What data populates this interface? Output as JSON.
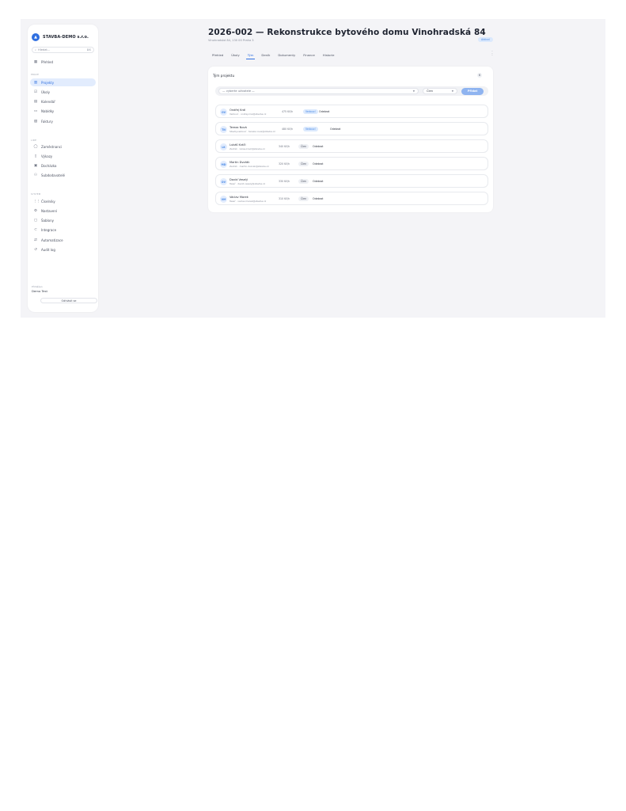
{
  "sidebar": {
    "brand": "STAVBA-DEMO s.r.o.",
    "search": {
      "placeholder": "Hledat...",
      "shortcut": "⌘K"
    },
    "items_top": [
      {
        "label": "Přehled",
        "icon": "dashboard-icon"
      }
    ],
    "group_work": "PRÁCE",
    "items_work": [
      {
        "label": "Projekty",
        "icon": "building-icon",
        "active": true
      },
      {
        "label": "Úkoly",
        "icon": "tasks-icon"
      },
      {
        "label": "Kalendář",
        "icon": "calendar-icon"
      },
      {
        "label": "Nabídky",
        "icon": "offer-icon"
      },
      {
        "label": "Faktury",
        "icon": "invoice-icon"
      }
    ],
    "group_people": "LIDÉ",
    "items_people": [
      {
        "label": "Zaměstnanci",
        "icon": "user-icon"
      },
      {
        "label": "Výkazy",
        "icon": "timesheet-icon"
      },
      {
        "label": "Docházka",
        "icon": "attendance-icon"
      },
      {
        "label": "Subdodavatelé",
        "icon": "people-icon"
      }
    ],
    "group_system": "SYSTÉM",
    "items_system": [
      {
        "label": "Číselníky",
        "icon": "grid-icon"
      },
      {
        "label": "Nastavení",
        "icon": "settings-icon"
      },
      {
        "label": "Šablony",
        "icon": "template-icon"
      },
      {
        "label": "Integrace",
        "icon": "plug-icon"
      },
      {
        "label": "Automatizace",
        "icon": "flow-icon"
      },
      {
        "label": "Audit log",
        "icon": "history-icon"
      }
    ],
    "footer": {
      "label": "Přihlášen",
      "user": "Demo Test",
      "logout": "Odhlásit se"
    }
  },
  "header": {
    "title": "2026-002 — Rekonstrukce bytového domu Vinohradská 84",
    "subtitle": "Vinohradská 84, 130 00 Praha 3",
    "status": "Aktivní",
    "tabs": [
      {
        "label": "Přehled"
      },
      {
        "label": "Úkoly"
      },
      {
        "label": "Tým",
        "active": true
      },
      {
        "label": "Deník"
      },
      {
        "label": "Dokumenty"
      },
      {
        "label": "Finance"
      },
      {
        "label": "Historie"
      }
    ]
  },
  "team": {
    "title": "Tým projektu",
    "count": "6",
    "worker_placeholder": "— vyberte uživatele —",
    "role_value": "Člen",
    "add_label": "Přidat",
    "members": [
      {
        "initials": "OV",
        "name": "Ondřej Král",
        "info": "Vedoucí · ondrej.kral@stavba.cz",
        "rate": "475 Kč/h",
        "role": "Vedoucí",
        "role_kind": "lead",
        "remove": "Odebrat"
      },
      {
        "initials": "TN",
        "name": "Tereza Nová",
        "info": "Stavbyvedoucí · tereza.nova@stavba.cz",
        "rate": "480 Kč/h",
        "role": "Vedoucí",
        "role_kind": "lead",
        "remove": "Odebrat"
      },
      {
        "initials": "LK",
        "name": "Lukáš Kráčl",
        "info": "Zedník · lukas.kracl@stavba.cz",
        "rate": "340 Kč/h",
        "role": "Člen",
        "role_kind": "clen",
        "remove": "Odebrat"
      },
      {
        "initials": "MD",
        "name": "Martin Dvořák",
        "info": "Zedník · martin.dvorak@stavba.cz",
        "rate": "320 Kč/h",
        "role": "Člen",
        "role_kind": "clen",
        "remove": "Odebrat"
      },
      {
        "initials": "DV",
        "name": "David Veselý",
        "info": "Tesař · david.vesely@stavba.cz",
        "rate": "330 Kč/h",
        "role": "Člen",
        "role_kind": "clen",
        "remove": "Odebrat"
      },
      {
        "initials": "VM",
        "name": "Václav Marek",
        "info": "Tesař · vaclav.marek@stavba.cz",
        "rate": "310 Kč/h",
        "role": "Člen",
        "role_kind": "clen",
        "remove": "Odebrat"
      }
    ]
  }
}
